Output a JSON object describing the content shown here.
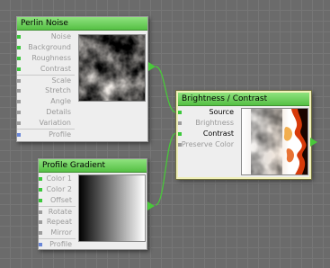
{
  "colors": {
    "canvas": "#6b6b6b",
    "grid": "#767676",
    "node_title": "#55c044",
    "wire": "#49c83a",
    "port_connected": "#3cc83c",
    "port_profile": "#6a87d8",
    "port_unconnected": "#9d9d9d"
  },
  "nodes": {
    "perlin_noise": {
      "title": "Perlin Noise",
      "ports": [
        {
          "label": "Noise",
          "state": "connected"
        },
        {
          "label": "Background",
          "state": "connected"
        },
        {
          "label": "Roughness",
          "state": "connected"
        },
        {
          "label": "Contrast",
          "state": "connected"
        },
        {
          "label": "Scale",
          "state": "unconnected"
        },
        {
          "label": "Stretch",
          "state": "unconnected"
        },
        {
          "label": "Angle",
          "state": "unconnected"
        },
        {
          "label": "Details",
          "state": "unconnected"
        },
        {
          "label": "Variation",
          "state": "unconnected"
        },
        {
          "label": "Profile",
          "state": "profile"
        }
      ]
    },
    "profile_gradient": {
      "title": "Profile Gradient",
      "ports": [
        {
          "label": "Color 1",
          "state": "connected"
        },
        {
          "label": "Color 2",
          "state": "connected"
        },
        {
          "label": "Offset",
          "state": "connected"
        },
        {
          "label": "Rotate",
          "state": "unconnected"
        },
        {
          "label": "Repeat",
          "state": "unconnected"
        },
        {
          "label": "Mirror",
          "state": "unconnected"
        },
        {
          "label": "Profile",
          "state": "profile"
        }
      ]
    },
    "brightness_contrast": {
      "title": "Brightness / Contrast",
      "ports": [
        {
          "label": "Source",
          "state": "connected",
          "active": true
        },
        {
          "label": "Brightness",
          "state": "unconnected"
        },
        {
          "label": "Contrast",
          "state": "connected",
          "active": true
        },
        {
          "label": "Preserve Color",
          "state": "unconnected"
        }
      ]
    }
  }
}
